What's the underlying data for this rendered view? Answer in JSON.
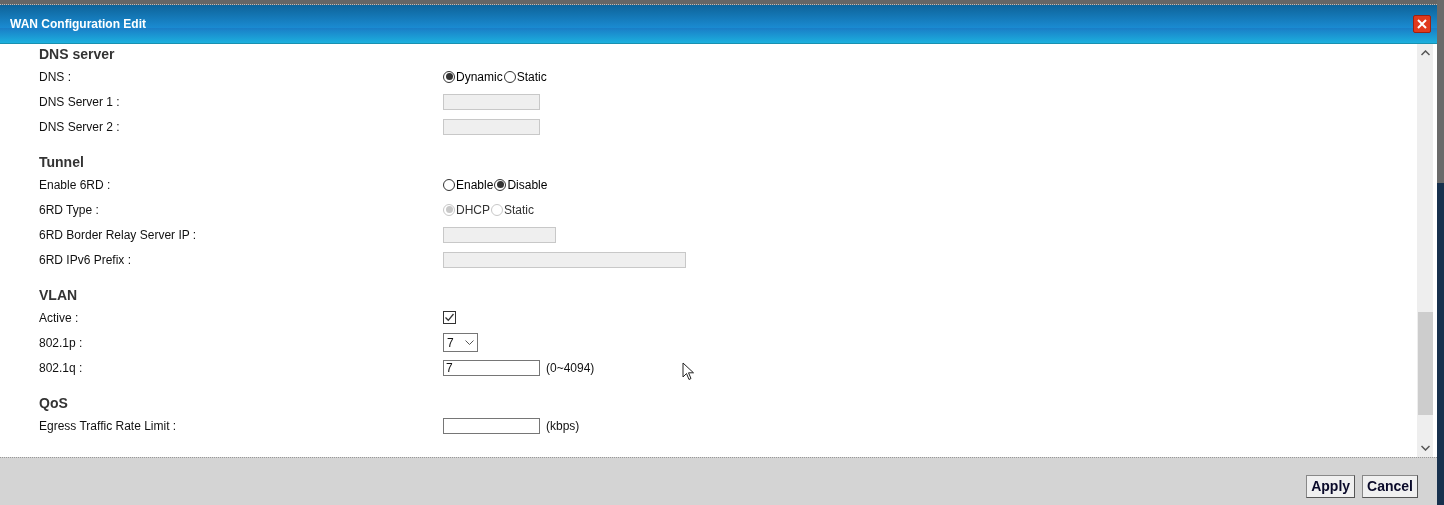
{
  "window": {
    "title": "WAN Configuration Edit"
  },
  "sections": [
    {
      "title": "DNS server",
      "rows": [
        {
          "label": "DNS :",
          "kind": "radio",
          "options": [
            {
              "label": "Dynamic",
              "selected": true,
              "disabled": false
            },
            {
              "label": "Static",
              "selected": false,
              "disabled": false
            }
          ]
        },
        {
          "label": "DNS Server 1 :",
          "kind": "text",
          "disabled": true
        },
        {
          "label": "DNS Server 2 :",
          "kind": "text",
          "disabled": true
        }
      ]
    },
    {
      "title": "Tunnel",
      "rows": [
        {
          "label": "Enable 6RD :",
          "kind": "radio",
          "options": [
            {
              "label": "Enable",
              "selected": false,
              "disabled": false
            },
            {
              "label": "Disable",
              "selected": true,
              "disabled": false
            }
          ]
        },
        {
          "label": "6RD Type :",
          "kind": "radio",
          "options": [
            {
              "label": "DHCP",
              "selected": true,
              "disabled": true
            },
            {
              "label": "Static",
              "selected": false,
              "disabled": true
            }
          ]
        },
        {
          "label": "6RD Border Relay Server IP :",
          "kind": "text",
          "disabled": true
        },
        {
          "label": "6RD IPv6 Prefix :",
          "kind": "text",
          "disabled": true
        }
      ]
    },
    {
      "title": "VLAN",
      "rows": [
        {
          "label": "Active :",
          "kind": "checkbox",
          "checked": true
        },
        {
          "label": "802.1p :",
          "kind": "select",
          "value": "7"
        },
        {
          "label": "802.1q :",
          "kind": "text",
          "disabled": false,
          "value": "7",
          "unit": "(0~4094)"
        }
      ]
    },
    {
      "title": "QoS",
      "rows": [
        {
          "label": "Egress Traffic Rate Limit :",
          "kind": "text",
          "disabled": false,
          "unit": "(kbps)"
        }
      ]
    }
  ],
  "buttons": [
    "Apply",
    "Cancel"
  ]
}
